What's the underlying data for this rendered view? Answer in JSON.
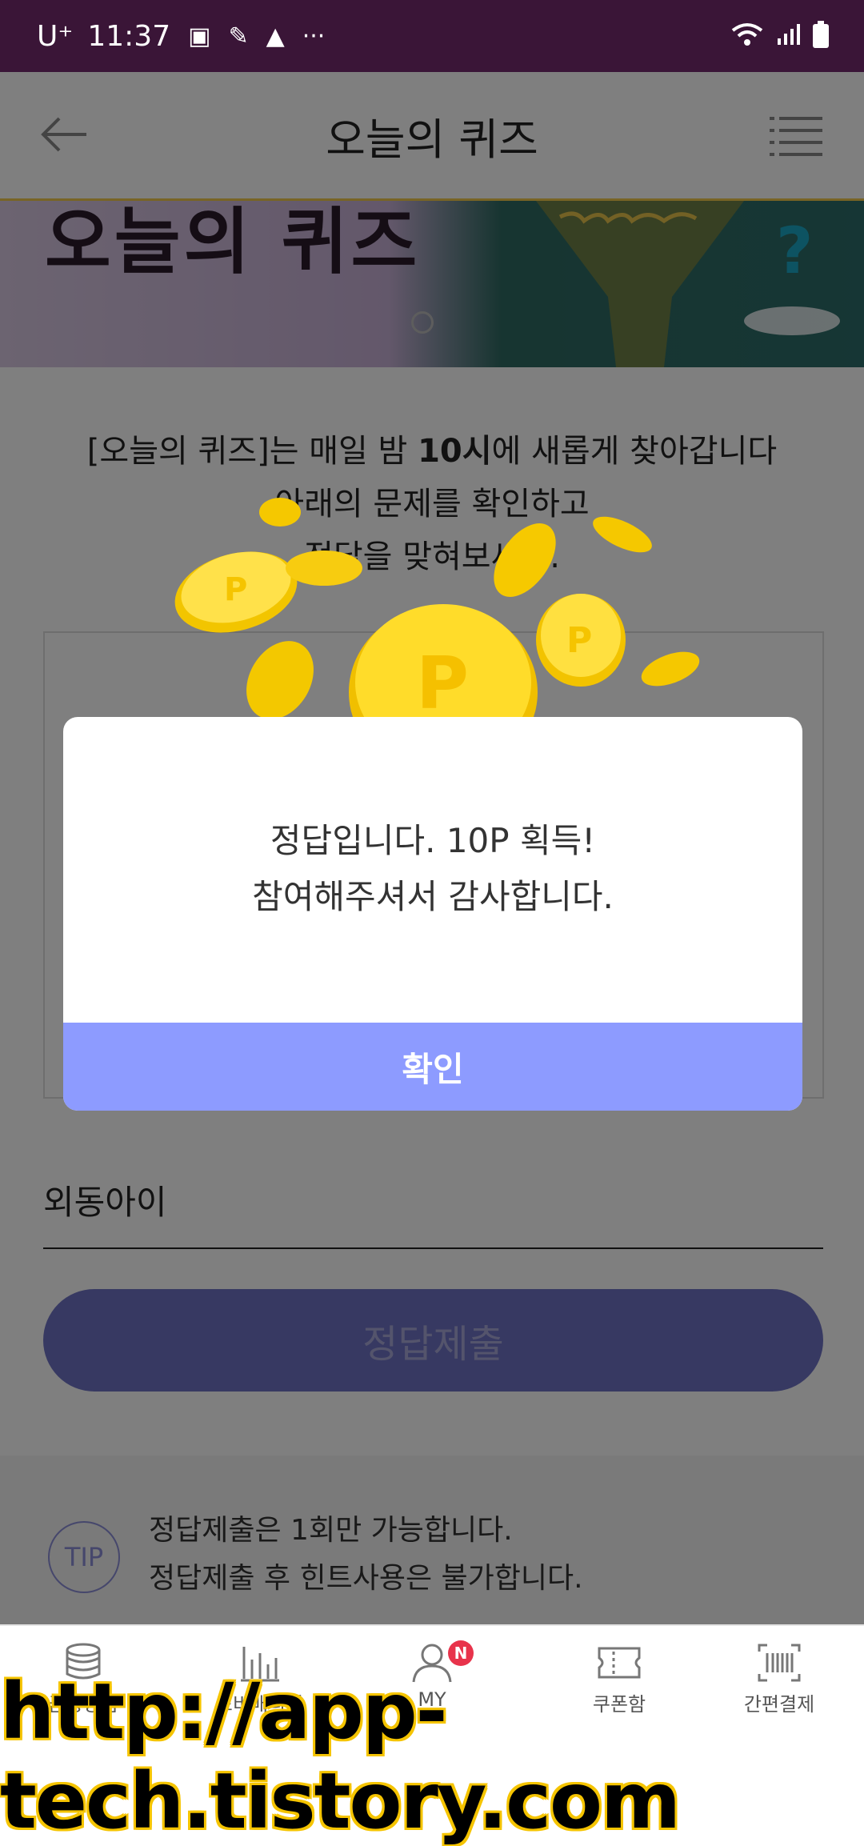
{
  "status_bar": {
    "carrier": "U⁺",
    "time": "11:37",
    "more": "···"
  },
  "header": {
    "title": "오늘의 퀴즈"
  },
  "banner": {
    "title": "오늘의 퀴즈"
  },
  "intro": {
    "line1_prefix": "[오늘의 퀴즈]는 매일 밤 ",
    "line1_bold": "10시",
    "line1_suffix": "에 새롭게 찾아갑니다",
    "line2": "아래의 문제를 확인하고",
    "line3": "정답을 맞혀보세요."
  },
  "answer_field": {
    "value": "외동아이"
  },
  "submit_button": {
    "label": "정답제출"
  },
  "tip": {
    "icon_label": "TIP",
    "line1": "정답제출은 1회만 가능합니다.",
    "line2": "정답제출 후 힌트사용은 불가합니다."
  },
  "dialog": {
    "line1": "정답입니다. 10P 획득!",
    "line2": "참여해주셔서 감사합니다.",
    "confirm_label": "확인"
  },
  "bottom_nav": [
    {
      "label": "금융상품",
      "icon": "coins-icon"
    },
    {
      "label": "소비매니저",
      "icon": "bar-chart-icon"
    },
    {
      "label": "MY",
      "icon": "person-icon",
      "badge": "N"
    },
    {
      "label": "쿠폰함",
      "icon": "ticket-icon"
    },
    {
      "label": "간편결제",
      "icon": "barcode-icon"
    }
  ],
  "watermark": "http://app-tech.tistory.com",
  "colors": {
    "status_bar": "#3a1537",
    "accent": "#8d9bff",
    "submit": "#6e73c4",
    "badge": "#e8334b"
  }
}
